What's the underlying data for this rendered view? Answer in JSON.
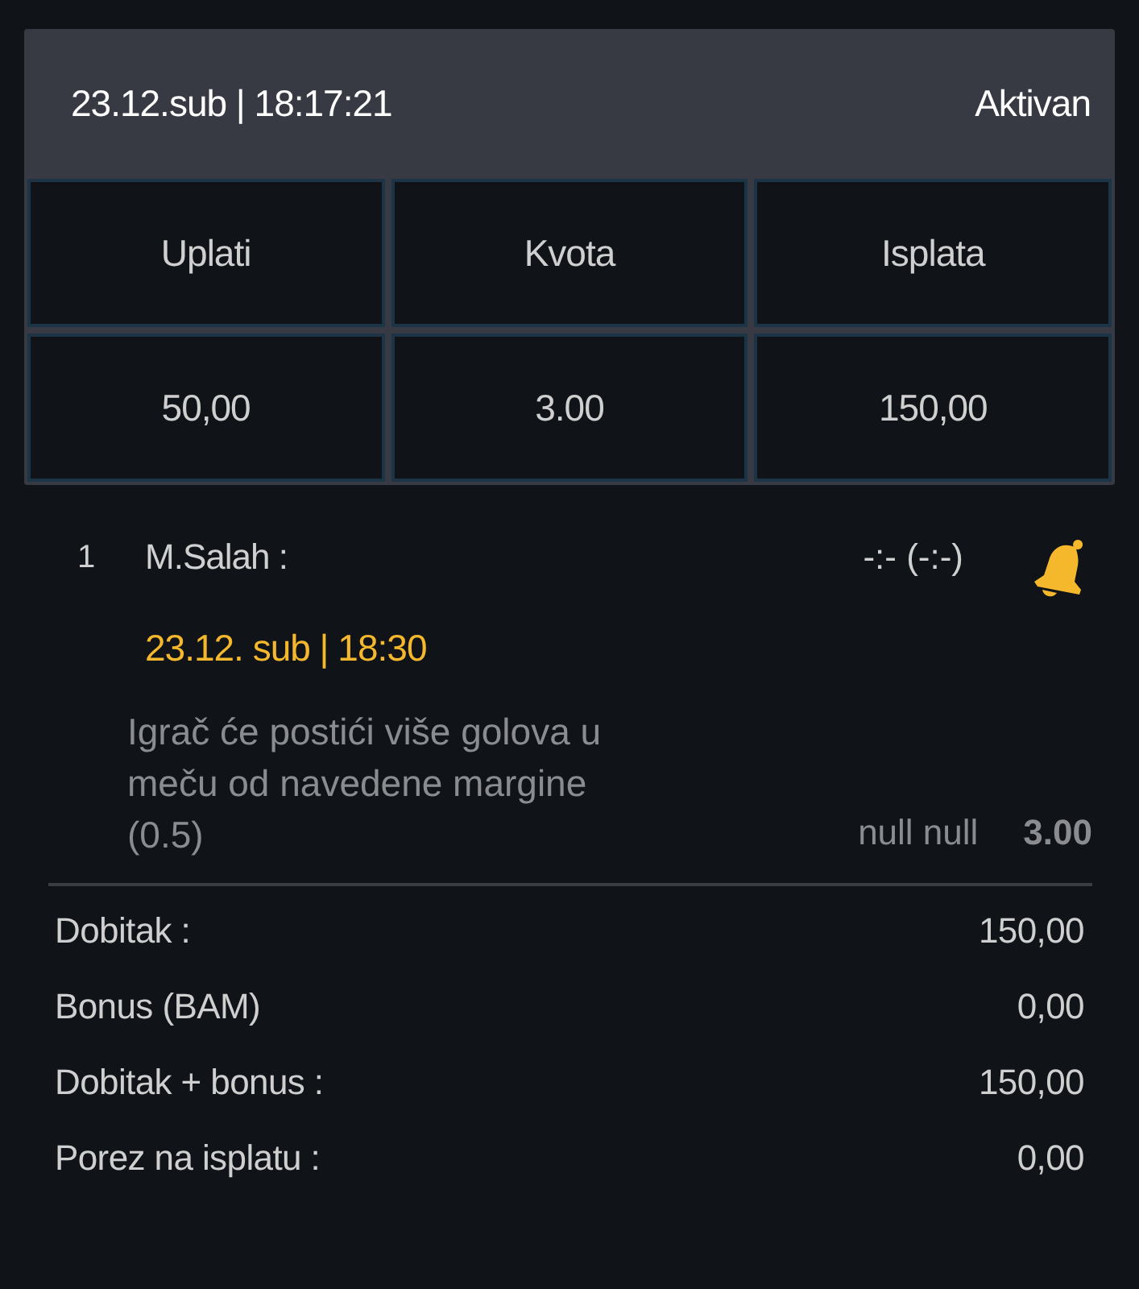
{
  "ticket": {
    "datetime": "23.12.sub | 18:17:21",
    "status": "Aktivan"
  },
  "grid": {
    "headers": [
      "Uplati",
      "Kvota",
      "Isplata"
    ],
    "values": [
      "50,00",
      "3.00",
      "150,00"
    ]
  },
  "selections": [
    {
      "number": "1",
      "player": "M.Salah :",
      "score": "-:- (-:-)",
      "event_time": "23.12. sub | 18:30",
      "market": "Igrač će postići više golova u meču od navedene margine (0.5)",
      "pick": "null null",
      "odds": "3.00"
    }
  ],
  "summary": [
    {
      "label": "Dobitak :",
      "value": "150,00"
    },
    {
      "label": "Bonus (BAM)",
      "value": "0,00"
    },
    {
      "label": "Dobitak + bonus :",
      "value": "150,00"
    },
    {
      "label": "Porez na isplatu :",
      "value": "0,00"
    }
  ]
}
